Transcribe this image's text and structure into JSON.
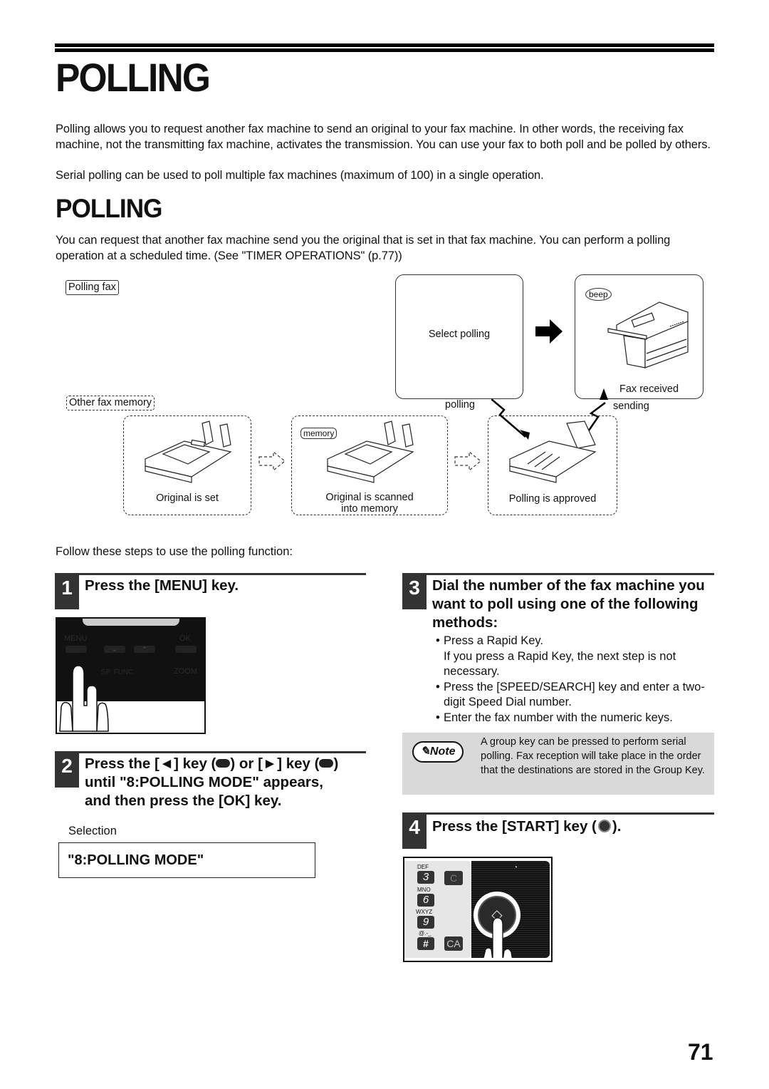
{
  "page": {
    "title": "POLLING",
    "intro": [
      "Polling allows you to request another fax machine to send an original to your fax machine. In other words, the receiving fax machine, not the transmitting fax machine, activates the transmission. You can use your fax to both poll and be polled by others.",
      "Serial polling can be used to poll multiple fax machines (maximum of 100) in a single operation."
    ],
    "page_number": "71"
  },
  "section": {
    "title": "POLLING",
    "description": "You can request that another fax machine send you the original that is set in that fax machine. You can perform a polling operation at a scheduled time. (See \"TIMER OPERATIONS\" (p.77))"
  },
  "diagram": {
    "polling_fax_label": "Polling fax",
    "other_fax_memory_label": "Other fax memory",
    "select_polling": "Select polling",
    "fax_received": "Fax received",
    "beep": "beep",
    "polling_label": "polling",
    "sending_label": "sending",
    "memory_label": "memory",
    "stages": [
      {
        "caption": "Original is set"
      },
      {
        "caption": "Original is scanned\ninto memory"
      },
      {
        "caption": "Polling is approved"
      }
    ]
  },
  "steps_intro": "Follow these steps to use the polling function:",
  "steps": [
    {
      "number": "1",
      "title": "Press the [MENU] key."
    },
    {
      "number": "2",
      "title_parts": [
        "Press the [",
        "] key (",
        ") or [",
        "] key (",
        ")"
      ],
      "title_line2": "until \"8:POLLING MODE\" appears,",
      "title_line3": "and then press the [OK] key.",
      "left_arrow": "◄",
      "right_arrow": "►",
      "selection_label": "Selection",
      "selection_value": "\"8:POLLING MODE\""
    },
    {
      "number": "3",
      "title": "Dial the number of the fax machine you want to poll using one of the following methods:",
      "bullets": [
        {
          "text": "Press a Rapid Key.",
          "sub": "If you press a Rapid Key, the next step is not necessary."
        },
        {
          "text": "Press the [SPEED/SEARCH] key and enter a two-digit Speed Dial number."
        },
        {
          "text": "Enter the fax number with the numeric keys."
        }
      ]
    },
    {
      "number": "4",
      "title_a": "Press the [START] key (",
      "title_b": ")."
    }
  ],
  "note": {
    "badge": "Note",
    "text": "A group key can be pressed to perform serial polling. Fax reception will take place in the order that the destinations are stored in the Group Key."
  },
  "panel1": {
    "keys": [
      "MENU",
      "◄",
      "►",
      "OK",
      "SP. FUNC",
      "ZOOM"
    ]
  },
  "panel4": {
    "keys": [
      {
        "sub": "DEF",
        "key": "3"
      },
      {
        "sub": "MNO",
        "key": "6"
      },
      {
        "sub": "WXYZ",
        "key": "9"
      },
      {
        "sub": "@.-_",
        "key": "#"
      }
    ],
    "clear": "C",
    "clear_all": "CA"
  }
}
